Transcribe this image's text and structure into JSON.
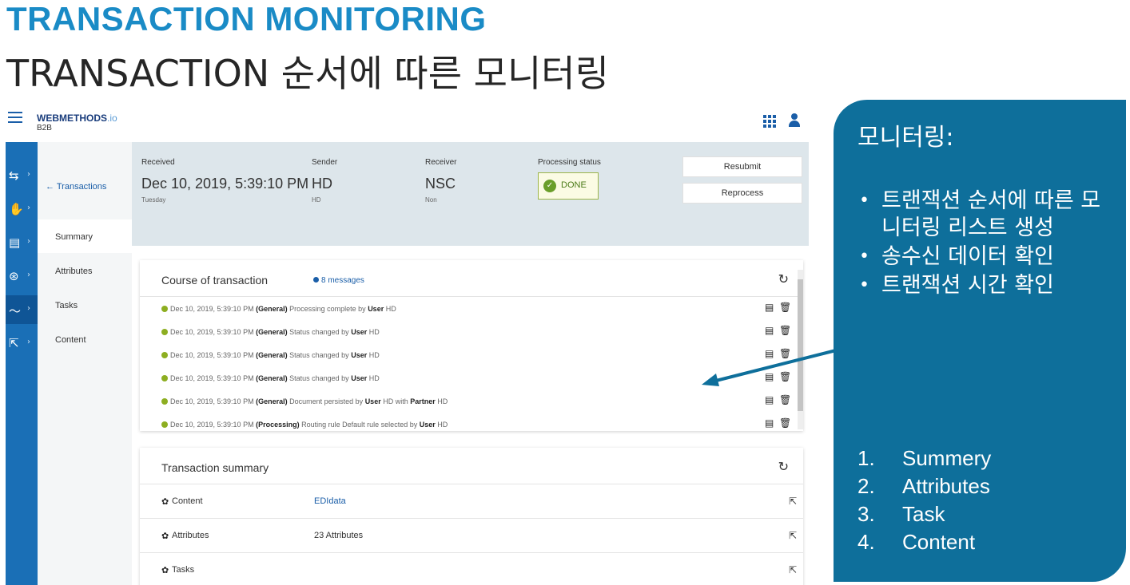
{
  "slide": {
    "title": "TRANSACTION MONITORING",
    "subtitle": "TRANSACTION 순서에 따른 모니터링"
  },
  "app": {
    "brand": "WEBMETHODS",
    "brand_suffix": ".io",
    "brand_sub": "B2B"
  },
  "rail": {
    "chevron": "›",
    "icons": [
      "transfer-icon",
      "handshake-icon",
      "document-icon",
      "network-icon",
      "monitoring-icon",
      "export-icon"
    ],
    "glyphs": [
      "⇆",
      "✋",
      "▤",
      "⊛",
      "〜",
      "⇱"
    ]
  },
  "subnav": {
    "back": "← Transactions",
    "items": [
      "Summary",
      "Attributes",
      "Tasks",
      "Content"
    ]
  },
  "header": {
    "received_label": "Received",
    "received_value": "Dec 10, 2019, 5:39:10 PM",
    "received_sub": "Tuesday",
    "sender_label": "Sender",
    "sender_value": "HD",
    "sender_sub": "HD",
    "receiver_label": "Receiver",
    "receiver_value": "NSC",
    "receiver_sub": "Non",
    "status_label": "Processing status",
    "status_value": "DONE",
    "resubmit": "Resubmit",
    "reprocess": "Reprocess"
  },
  "course": {
    "title": "Course of transaction",
    "count": "8 messages",
    "messages": [
      {
        "time": "Dec 10, 2019, 5:39:10 PM",
        "category": "(General)",
        "text": "Processing complete by",
        "by": "User",
        "who": "HD",
        "extra_label": "",
        "extra_value": ""
      },
      {
        "time": "Dec 10, 2019, 5:39:10 PM",
        "category": "(General)",
        "text": "Status changed by",
        "by": "User",
        "who": "HD",
        "extra_label": "",
        "extra_value": ""
      },
      {
        "time": "Dec 10, 2019, 5:39:10 PM",
        "category": "(General)",
        "text": "Status changed by",
        "by": "User",
        "who": "HD",
        "extra_label": "",
        "extra_value": ""
      },
      {
        "time": "Dec 10, 2019, 5:39:10 PM",
        "category": "(General)",
        "text": "Status changed by",
        "by": "User",
        "who": "HD",
        "extra_label": "",
        "extra_value": ""
      },
      {
        "time": "Dec 10, 2019, 5:39:10 PM",
        "category": "(General)",
        "text": "Document persisted by",
        "by": "User",
        "who": "HD with",
        "extra_label": "Partner",
        "extra_value": "HD"
      },
      {
        "time": "Dec 10, 2019, 5:39:10 PM",
        "category": "(Processing)",
        "text": "Routing rule Default rule selected by",
        "by": "User",
        "who": "HD",
        "extra_label": "",
        "extra_value": ""
      }
    ]
  },
  "summary": {
    "title": "Transaction summary",
    "rows": [
      {
        "label": "Content",
        "value": "EDIdata"
      },
      {
        "label": "Attributes",
        "value": "23 Attributes"
      },
      {
        "label": "Tasks",
        "value": ""
      }
    ]
  },
  "callout": {
    "title": "모니터링:",
    "bullets": [
      "트랜잭션 순서에 따른 모니터링 리스트 생성",
      "송수신  데이터 확인",
      "트랜잭션 시간 확인"
    ],
    "numbered": [
      {
        "num": "1.",
        "text": "Summery"
      },
      {
        "num": "2.",
        "text": "Attributes"
      },
      {
        "num": "3.",
        "text": "Task"
      },
      {
        "num": "4.",
        "text": "Content"
      }
    ]
  },
  "colors": {
    "title_blue": "#1a8bc6",
    "rail_blue": "#1a6fb6",
    "callout_teal": "#0e6f9b",
    "status_green": "#6a9e2a"
  }
}
